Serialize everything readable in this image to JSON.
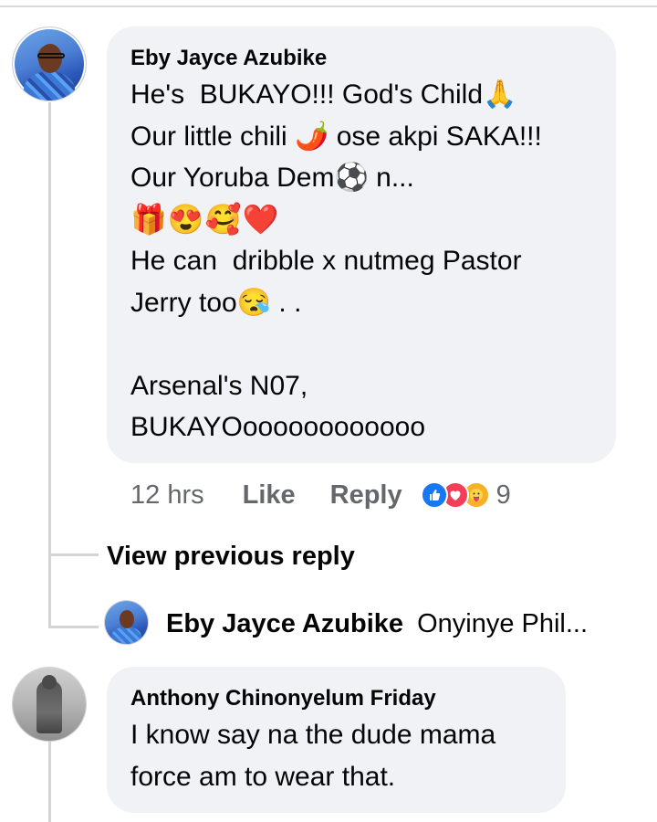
{
  "comment_1": {
    "author": "Eby Jayce Azubike",
    "lines": [
      "He's  BUKAYO!!! God's Child🙏",
      "Our little chili 🌶️ ose akpi SAKA!!!",
      "Our Yoruba Dem⚽ n...",
      "🎁😍🥰❤️",
      "He can  dribble x nutmeg Pastor",
      "Jerry too😪 . .",
      "",
      "Arsenal's N07,",
      "BUKAYOoooooooooooo"
    ],
    "time": "12 hrs",
    "like_label": "Like",
    "reply_label": "Reply",
    "reaction_count": "9",
    "reaction_icons": [
      "like-reaction-icon",
      "love-reaction-icon",
      "care-reaction-icon"
    ],
    "reaction_colors": {
      "like": "#1877f2",
      "love": "#f33e58",
      "care": "#f7b125"
    }
  },
  "replies": {
    "view_previous_label": "View previous reply",
    "preview_author": "Eby Jayce Azubike",
    "preview_snippet": "Onyinye Phil..."
  },
  "comment_2": {
    "author": "Anthony Chinonyelum Friday",
    "lines": [
      "I know say na the dude mama",
      "force am to wear that."
    ]
  },
  "theme": {
    "bubble_background": "#f0f2f5",
    "meta_text": "#65676b",
    "primary_text": "#050505"
  }
}
